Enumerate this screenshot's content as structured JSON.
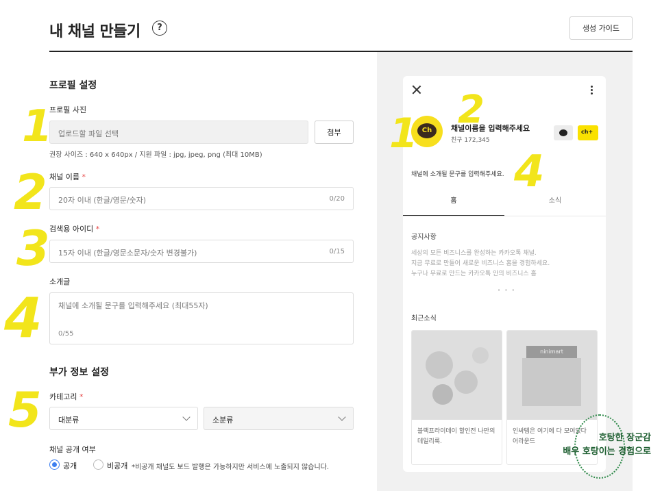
{
  "header": {
    "title": "내 채널 만들기",
    "help_icon": "?",
    "guide_label": "생성 가이드"
  },
  "profile": {
    "section_title": "프로필 설정",
    "photo_label": "프로필 사진",
    "file_placeholder": "업로드할 파일 선택",
    "attach_label": "첨부",
    "hint": "권장 사이즈 : 640 x 640px / 지원 파일 : jpg, jpeg, png (최대 10MB)",
    "name_label": "채널 이름",
    "name_placeholder": "20자 이내 (한글/영문/숫자)",
    "name_count": "0/20",
    "id_label": "검색용 아이디",
    "id_placeholder": "15자 이내 (한글/영문소문자/숫자 변경불가)",
    "id_count": "0/15",
    "intro_label": "소개글",
    "intro_placeholder": "채널에 소개될 문구를 입력해주세요 (최대55자)",
    "intro_count": "0/55",
    "required_mark": "*"
  },
  "extra": {
    "section_title": "부가 정보 설정",
    "category_label": "카테고리",
    "category_main": "대분류",
    "category_sub": "소분류",
    "visibility_label": "채널 공개 여부",
    "public_label": "공개",
    "private_label": "비공개",
    "private_note": "*비공개 채널도 보드 발행은 가능하지만 서비스에 노출되지 않습니다."
  },
  "preview": {
    "channel_name": "채널이름을 입력해주세요",
    "friend_count": "친구 172,345",
    "logo_text": "Ch",
    "add_icon_text": "ch+",
    "description": "채널에 소개될 문구를 입력해주세요.",
    "tab_home": "홈",
    "tab_news": "소식",
    "notice_title": "공지사항",
    "notice_line1": "세상의 모든 비즈니스를 완성하는 카카오톡 채널.",
    "notice_line2": "지금 무료로 만들어 새로운 비즈니스 홈을 경험하세요.",
    "notice_line3": "누구나 무료로 만드는 카카오톡 안의 비즈니스 홈",
    "dots": "• • •",
    "news_title": "최근소식",
    "card1_text": "블랙프라이데이 할인전 나만의 데일리룩.",
    "card2_text": "인싸템은 여기에 다 모여있다 어라운드",
    "shop_sign": "ninimart"
  },
  "scribbles": {
    "n1": "1",
    "n2": "2",
    "n3": "3",
    "n4": "4",
    "n5": "5",
    "p1": "1",
    "p2": "2",
    "p4": "4"
  },
  "watermark": {
    "line1": "호탕한 장군감",
    "line2": "배우 호탕이는 경험으로"
  },
  "colors": {
    "accent_yellow": "#fae100",
    "radio_blue": "#3d7ff0",
    "required_red": "#e64545",
    "scribble_yellow": "#f2e51b"
  }
}
